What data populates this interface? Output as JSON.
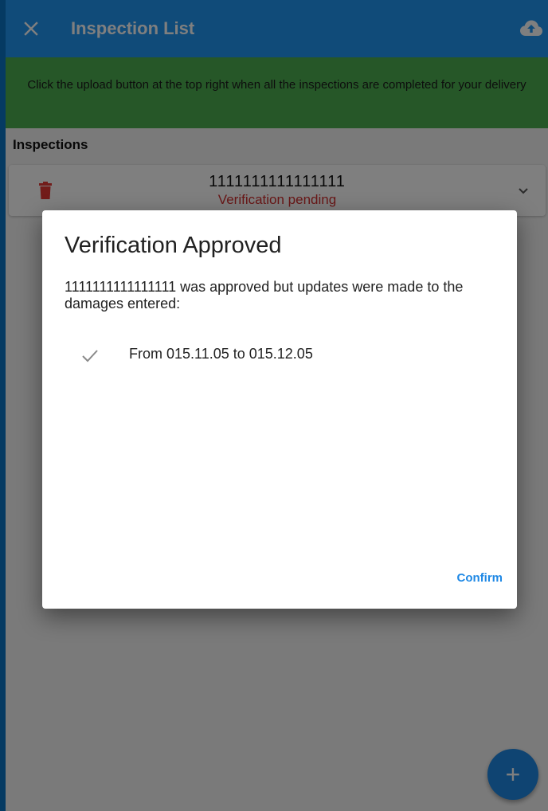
{
  "appbar": {
    "title": "Inspection List",
    "close_icon": "close-icon",
    "upload_icon": "cloud-upload-icon",
    "color": "#2196f3"
  },
  "banner": {
    "text": "Click the upload button at the top right when all the inspections are completed for your delivery",
    "color": "#4caf50"
  },
  "inspections": {
    "section_label": "Inspections",
    "items": [
      {
        "number": "1111111111111111",
        "status": "Verification pending",
        "status_color": "#d32f2f"
      }
    ]
  },
  "dialog": {
    "title": "Verification Approved",
    "message": "1111111111111111 was approved but updates were made to the damages entered:",
    "changes": [
      {
        "icon": "check-icon",
        "text": "From 015.11.05 to 015.12.05"
      }
    ],
    "confirm_label": "Confirm",
    "accent": "#1e88e5"
  },
  "fab": {
    "icon": "plus-icon",
    "label": "+"
  }
}
